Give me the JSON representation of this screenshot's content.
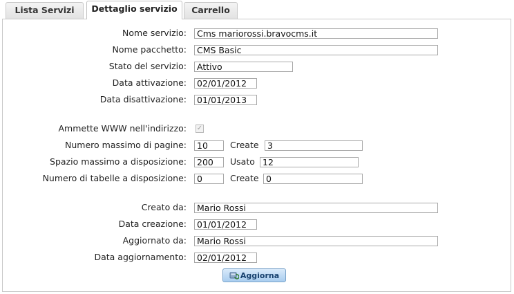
{
  "tabs": [
    {
      "label": "Lista Servizi"
    },
    {
      "label": "Dettaglio servizio"
    },
    {
      "label": "Carrello"
    }
  ],
  "form": {
    "nome_servizio": {
      "label": "Nome servizio:",
      "value": "Cms mariorossi.bravocms.it"
    },
    "nome_pacchetto": {
      "label": "Nome pacchetto:",
      "value": "CMS Basic"
    },
    "stato_servizio": {
      "label": "Stato del servizio:",
      "value": "Attivo"
    },
    "data_attivazione": {
      "label": "Data attivazione:",
      "value": "02/01/2012"
    },
    "data_disattivazione": {
      "label": "Data disattivazione:",
      "value": "01/01/2013"
    },
    "ammette_www": {
      "label": "Ammette WWW nell'indirizzo:",
      "checked": true
    },
    "numero_pagine": {
      "label": "Numero massimo di pagine:",
      "value": "10",
      "sub_label": "Create",
      "sub_value": "3"
    },
    "spazio": {
      "label": "Spazio massimo a disposizione:",
      "value": "200",
      "sub_label": "Usato",
      "sub_value": "12"
    },
    "tabelle": {
      "label": "Numero di tabelle a disposizione:",
      "value": "0",
      "sub_label": "Create",
      "sub_value": "0"
    },
    "creato_da": {
      "label": "Creato da:",
      "value": "Mario Rossi"
    },
    "data_creazione": {
      "label": "Data creazione:",
      "value": "01/01/2012"
    },
    "aggiornato_da": {
      "label": "Aggiornato da:",
      "value": "Mario Rossi"
    },
    "data_aggiornamento": {
      "label": "Data aggiornamento:",
      "value": "02/01/2012"
    }
  },
  "actions": {
    "aggiorna_label": "Aggiorna",
    "aggiorna_icon": "refresh-icon"
  }
}
